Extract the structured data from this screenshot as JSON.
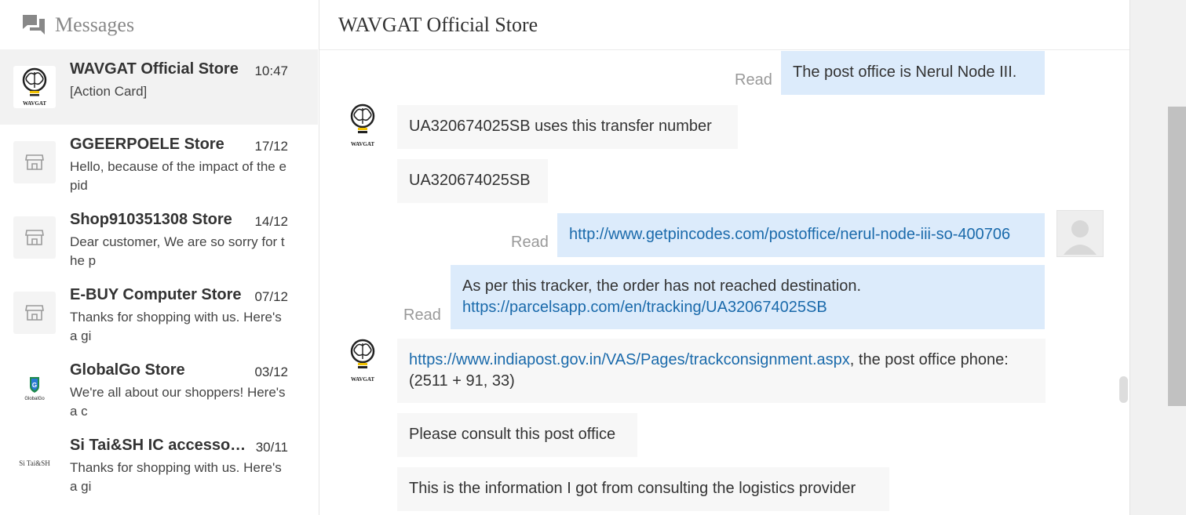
{
  "sidebar": {
    "title": "Messages",
    "conversations": [
      {
        "name": "WAVGAT Official Store",
        "date": "10:47",
        "snippet": "[Action Card]",
        "avatar": "wavgat-logo"
      },
      {
        "name": "GGEERPOELE Store",
        "date": "17/12",
        "snippet": "Hello, because of the impact of the epid",
        "avatar": "store-icon"
      },
      {
        "name": "Shop910351308 Store",
        "date": "14/12",
        "snippet": "Dear customer, We are so sorry for the p",
        "avatar": "store-icon"
      },
      {
        "name": "E-BUY Computer Store",
        "date": "07/12",
        "snippet": "Thanks for shopping with us. Here's a gi",
        "avatar": "store-icon"
      },
      {
        "name": "GlobalGo Store",
        "date": "03/12",
        "snippet": "We're all about our shoppers! Here's a c",
        "avatar": "globalgo-logo",
        "avatar_text": "GlobalGo"
      },
      {
        "name": "Si Tai&SH IC accessories Store",
        "date": "30/11",
        "snippet": "Thanks for shopping with us. Here's a gi",
        "avatar": "sitai-logo",
        "avatar_text": "Si Tai&SH"
      }
    ]
  },
  "chat": {
    "title": "WAVGAT Official Store",
    "read_label": "Read",
    "messages": [
      {
        "dir": "out",
        "text": "The post office is Nerul Node III.",
        "read": true
      },
      {
        "dir": "in",
        "text": "UA320674025SB uses this transfer number"
      },
      {
        "dir": "in",
        "text": "UA320674025SB"
      },
      {
        "dir": "out",
        "link": "http://www.getpincodes.com/postoffice/nerul-node-iii-so-400706",
        "read": true
      },
      {
        "dir": "out",
        "text": "As per this tracker, the order has not reached destination.",
        "link": "https://parcelsapp.com/en/tracking/UA320674025SB",
        "read": true
      },
      {
        "dir": "in",
        "link": "https://www.indiapost.gov.in/VAS/Pages/trackconsignment.aspx",
        "text": ", the post office phone: (2511 + 91, 33)"
      },
      {
        "dir": "in",
        "text": "Please consult this post office"
      },
      {
        "dir": "in",
        "text": "This is the information I got from consulting the logistics provider"
      }
    ]
  },
  "logo_text": "WAVGAT",
  "icons": {
    "messages": "chat-bubbles-icon",
    "store": "store-icon",
    "avatar": "user-avatar-icon"
  },
  "colors": {
    "outgoing_bubble": "#dcebfb",
    "incoming_bubble": "#f7f7f7",
    "link": "#1a6aab",
    "active_row": "#f2f2f2"
  }
}
